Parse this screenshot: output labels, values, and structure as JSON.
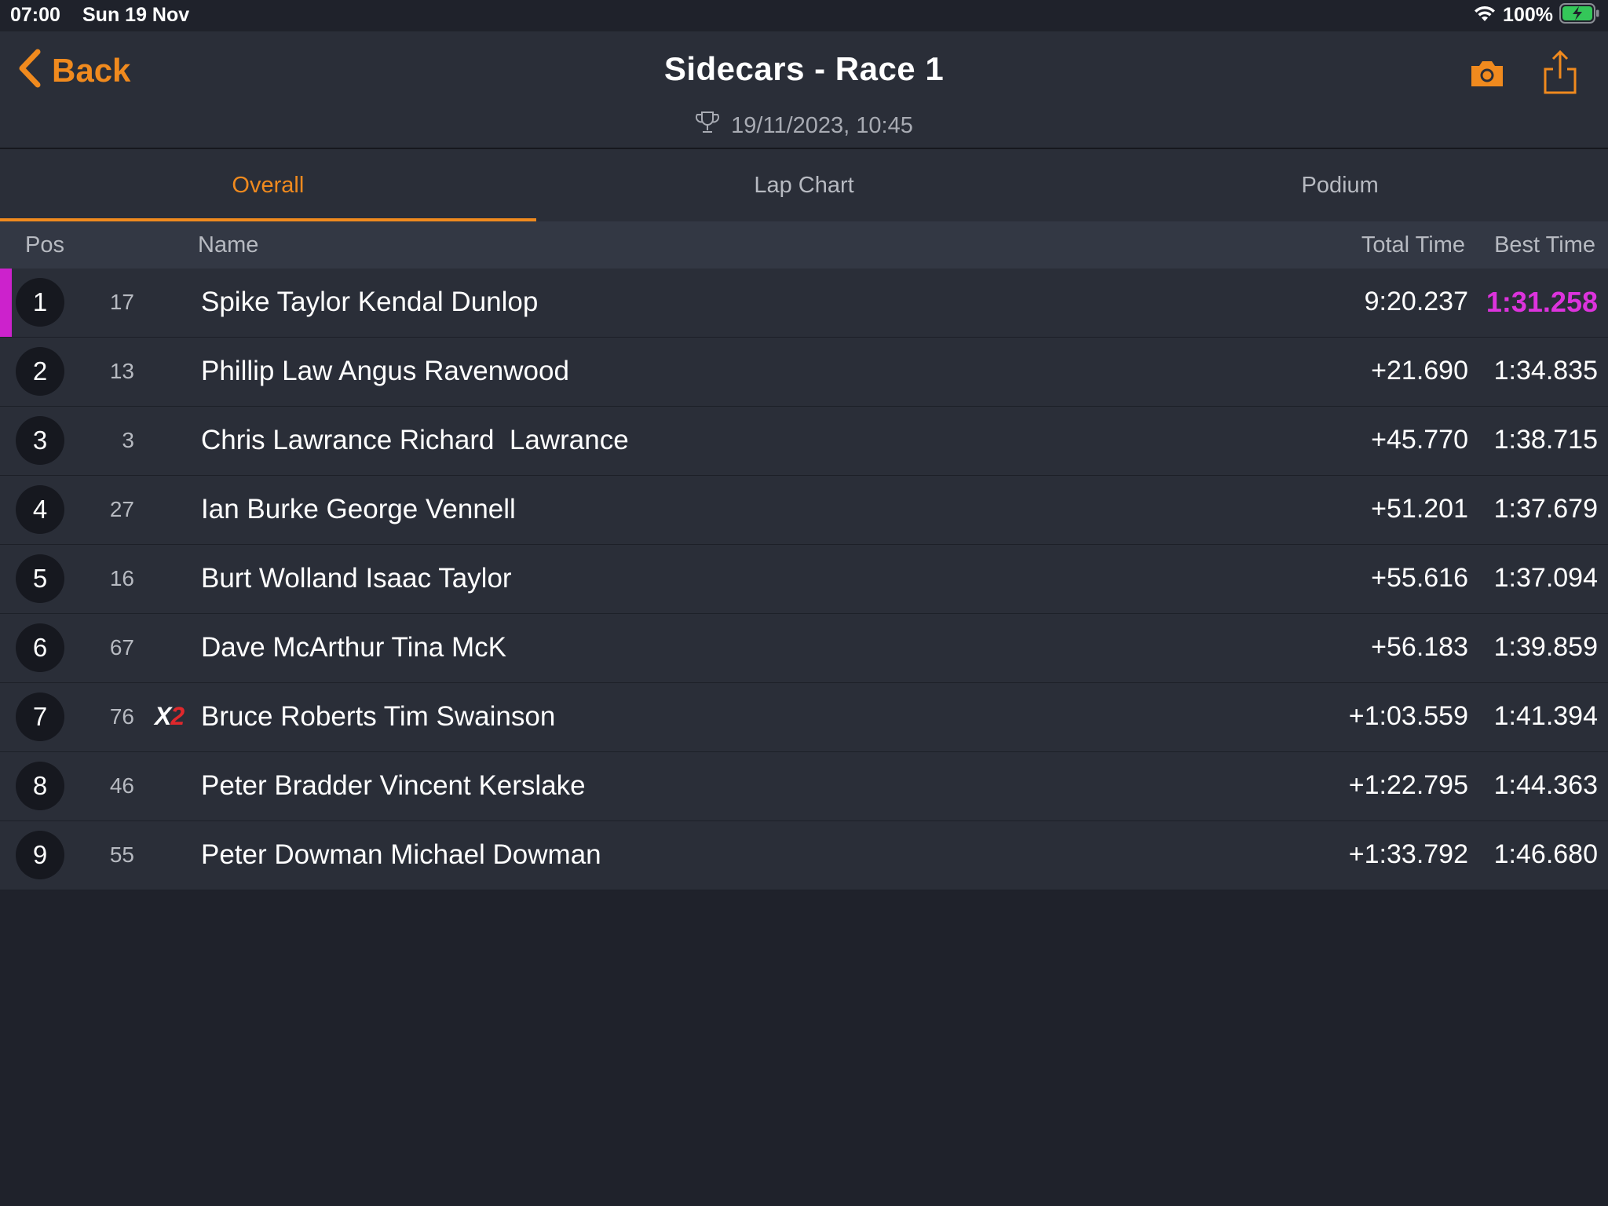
{
  "status_bar": {
    "time": "07:00",
    "date": "Sun 19 Nov",
    "battery": "100%"
  },
  "header": {
    "back_label": "Back",
    "title": "Sidecars - Race 1",
    "datetime": "19/11/2023, 10:45"
  },
  "tabs": [
    {
      "label": "Overall",
      "active": true
    },
    {
      "label": "Lap Chart",
      "active": false
    },
    {
      "label": "Podium",
      "active": false
    }
  ],
  "columns": {
    "pos": "Pos",
    "name": "Name",
    "total": "Total Time",
    "best": "Best Time"
  },
  "rows": [
    {
      "pos": "1",
      "num": "17",
      "name": "Spike Taylor Kendal Dunlop",
      "total": "9:20.237",
      "best": "1:31.258"
    },
    {
      "pos": "2",
      "num": "13",
      "name": "Phillip Law Angus Ravenwood",
      "total": "+21.690",
      "best": "1:34.835"
    },
    {
      "pos": "3",
      "num": "3",
      "name": "Chris Lawrance Richard  Lawrance",
      "total": "+45.770",
      "best": "1:38.715"
    },
    {
      "pos": "4",
      "num": "27",
      "name": "Ian Burke George Vennell",
      "total": "+51.201",
      "best": "1:37.679"
    },
    {
      "pos": "5",
      "num": "16",
      "name": "Burt Wolland Isaac Taylor",
      "total": "+55.616",
      "best": "1:37.094"
    },
    {
      "pos": "6",
      "num": "67",
      "name": "Dave McArthur Tina McK",
      "total": "+56.183",
      "best": "1:39.859"
    },
    {
      "pos": "7",
      "num": "76",
      "badge": "X2",
      "name": "Bruce Roberts Tim Swainson",
      "total": "+1:03.559",
      "best": "1:41.394"
    },
    {
      "pos": "8",
      "num": "46",
      "name": "Peter Bradder Vincent Kerslake",
      "total": "+1:22.795",
      "best": "1:44.363"
    },
    {
      "pos": "9",
      "num": "55",
      "name": "Peter Dowman Michael Dowman",
      "total": "+1:33.792",
      "best": "1:46.680"
    }
  ],
  "colors": {
    "accent": "#f08a1e",
    "fastest": "#dd33dd",
    "background": "#1f222b",
    "row": "#2a2e38"
  }
}
